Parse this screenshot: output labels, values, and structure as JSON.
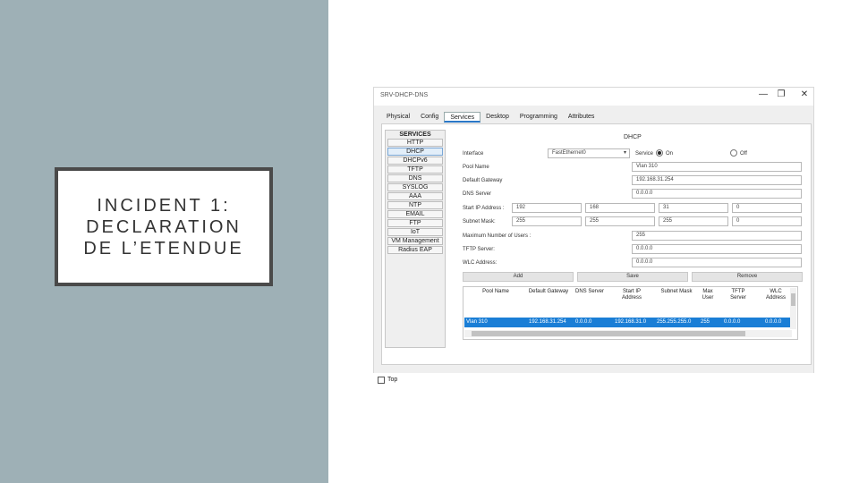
{
  "slide": {
    "title_line1": "INCIDENT 1:",
    "title_line2": "DECLARATION",
    "title_line3": "DE L’ETENDUE"
  },
  "window": {
    "title": "SRV-DHCP-DNS",
    "controls": {
      "minimize": "—",
      "maximize": "❐",
      "close": "✕"
    },
    "tabs": [
      "Physical",
      "Config",
      "Services",
      "Desktop",
      "Programming",
      "Attributes"
    ],
    "active_tab": "Services",
    "top_checkbox_label": "Top"
  },
  "services": {
    "header": "SERVICES",
    "items": [
      "HTTP",
      "DHCP",
      "DHCPv6",
      "TFTP",
      "DNS",
      "SYSLOG",
      "AAA",
      "NTP",
      "EMAIL",
      "FTP",
      "IoT",
      "VM Management",
      "Radius EAP"
    ],
    "selected": "DHCP"
  },
  "dhcp": {
    "heading": "DHCP",
    "interface_label": "Interface",
    "interface_value": "FastEthernet0",
    "service_label": "Service",
    "on_label": "On",
    "off_label": "Off",
    "service_on": true,
    "pool_name_label": "Pool Name",
    "pool_name_value": "Vlan 310",
    "gateway_label": "Default Gateway",
    "gateway_value": "192.168.31.254",
    "dns_label": "DNS Server",
    "dns_value": "0.0.0.0",
    "start_ip_label": "Start IP Address :",
    "start_ip": [
      "192",
      "168",
      "31",
      "0"
    ],
    "subnet_label": "Subnet Mask:",
    "subnet": [
      "255",
      "255",
      "255",
      "0"
    ],
    "max_users_label": "Maximum Number of Users :",
    "max_users_value": "255",
    "tftp_label": "TFTP Server:",
    "tftp_value": "0.0.0.0",
    "wlc_label": "WLC Address:",
    "wlc_value": "0.0.0.0",
    "add_button": "Add",
    "save_button": "Save",
    "remove_button": "Remove"
  },
  "pool_table": {
    "headers": [
      "Pool Name",
      "Default Gateway",
      "DNS Server",
      "Start IP Address",
      "Subnet Mask",
      "Max User",
      "TFTP Server",
      "WLC Address"
    ],
    "rows": [
      [
        "Vlan 310",
        "192.168.31.254",
        "0.0.0.0",
        "192.168.31.0",
        "255.255.255.0",
        "255",
        "0.0.0.0",
        "0.0.0.0"
      ]
    ]
  },
  "colors": {
    "left_panel": "#9eb0b6",
    "selection_blue": "#1a7ed6",
    "title_border": "#4a4a4a"
  }
}
